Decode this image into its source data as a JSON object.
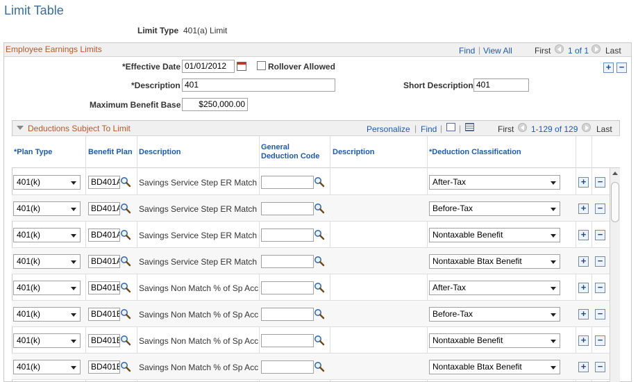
{
  "page": {
    "title": "Limit Table"
  },
  "header": {
    "limit_type_label": "Limit Type",
    "limit_type_value": "401(a) Limit"
  },
  "earnings_section": {
    "title": "Employee Earnings Limits",
    "find_label": "Find",
    "view_all_label": "View All",
    "first_label": "First",
    "count_label": "1 of 1",
    "last_label": "Last",
    "effective_date_label": "*Effective Date",
    "effective_date_value": "01/01/2012",
    "rollover_label": "Rollover Allowed",
    "description_label": "*Description",
    "description_value": "401",
    "short_description_label": "Short Description",
    "short_description_value": "401",
    "max_benefit_label": "Maximum Benefit Base",
    "max_benefit_value": "$250,000.00"
  },
  "deductions": {
    "title": "Deductions Subject To Limit",
    "personalize_label": "Personalize",
    "find_label": "Find",
    "first_label": "First",
    "count_label": "1-129 of 129",
    "last_label": "Last",
    "columns": {
      "plan_type": "*Plan Type",
      "benefit_plan": "Benefit Plan",
      "description": "Description",
      "general_deduction_line1": "General",
      "general_deduction_line2": "Deduction Code",
      "description2": "Description",
      "deduction_classification": "*Deduction Classification"
    },
    "rows": [
      {
        "plan_type": "401(k)",
        "benefit_plan": "BD401A",
        "description": "Savings Service Step ER Match",
        "ded_code": "",
        "classification": "After-Tax"
      },
      {
        "plan_type": "401(k)",
        "benefit_plan": "BD401A",
        "description": "Savings Service Step ER Match",
        "ded_code": "",
        "classification": "Before-Tax"
      },
      {
        "plan_type": "401(k)",
        "benefit_plan": "BD401A",
        "description": "Savings Service Step ER Match",
        "ded_code": "",
        "classification": "Nontaxable Benefit"
      },
      {
        "plan_type": "401(k)",
        "benefit_plan": "BD401A",
        "description": "Savings Service Step ER Match",
        "ded_code": "",
        "classification": "Nontaxable Btax Benefit"
      },
      {
        "plan_type": "401(k)",
        "benefit_plan": "BD401B",
        "description": "Savings Non Match % of Sp Acc",
        "ded_code": "",
        "classification": "After-Tax"
      },
      {
        "plan_type": "401(k)",
        "benefit_plan": "BD401B",
        "description": "Savings Non Match % of Sp Acc",
        "ded_code": "",
        "classification": "Before-Tax"
      },
      {
        "plan_type": "401(k)",
        "benefit_plan": "BD401B",
        "description": "Savings Non Match % of Sp Acc",
        "ded_code": "",
        "classification": "Nontaxable Benefit"
      },
      {
        "plan_type": "401(k)",
        "benefit_plan": "BD401B",
        "description": "Savings Non Match % of Sp Acc",
        "ded_code": "",
        "classification": "Nontaxable Btax Benefit"
      }
    ]
  },
  "icons": {
    "plus": "+",
    "minus": "−"
  },
  "colors": {
    "title": "#3a6d9a",
    "section_title": "#b1592b",
    "link": "#1f5aa6"
  }
}
